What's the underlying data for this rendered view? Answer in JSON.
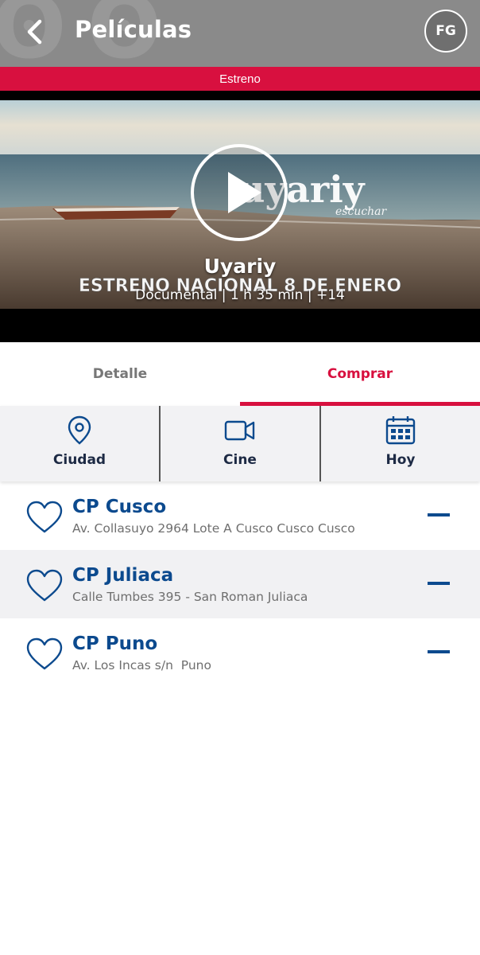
{
  "header": {
    "title": "Películas",
    "back_icon": "chevron-left-icon",
    "avatar_initials": "FG",
    "background_color": "#8a8a8a"
  },
  "badge": {
    "label": "Estreno",
    "color": "#d8103f"
  },
  "video": {
    "play_icon": "play-icon",
    "poster_logo": "uyariy",
    "poster_logo_tagline": "escuchar",
    "poster_banner": "ESTRENO NACIONAL 8 DE ENERO",
    "title": "Uyariy",
    "meta": "Documental | 1 h 35 min | +14"
  },
  "tabs": [
    {
      "label": "Detalle",
      "active": false
    },
    {
      "label": "Comprar",
      "active": true
    }
  ],
  "filters": [
    {
      "label": "Ciudad",
      "icon": "location-pin-icon"
    },
    {
      "label": "Cine",
      "icon": "video-camera-icon"
    },
    {
      "label": "Hoy",
      "icon": "calendar-icon"
    }
  ],
  "cinemas": [
    {
      "name": "CP Cusco",
      "address": "Av. Collasuyo 2964 Lote A Cusco Cusco Cusco",
      "favorite_icon": "heart-outline-icon",
      "toggle_icon": "minus-icon"
    },
    {
      "name": "CP Juliaca",
      "address": "Calle Tumbes 395 - San Roman Juliaca",
      "favorite_icon": "heart-outline-icon",
      "toggle_icon": "minus-icon"
    },
    {
      "name": "CP Puno",
      "address": "Av. Los Incas s/n  Puno",
      "favorite_icon": "heart-outline-icon",
      "toggle_icon": "minus-icon"
    }
  ],
  "colors": {
    "accent": "#d8103f",
    "link_blue": "#0c4a8e",
    "filter_text": "#1d2a44"
  }
}
